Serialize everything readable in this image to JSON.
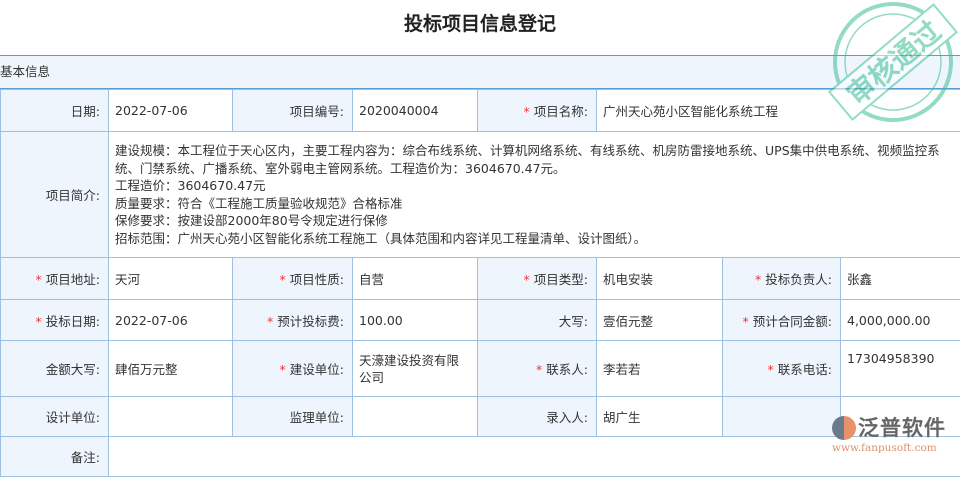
{
  "title": "投标项目信息登记",
  "section": "基本信息",
  "rows": {
    "date_label": "日期:",
    "date": "2022-07-06",
    "code_label": "项目编号:",
    "code": "2020040004",
    "name_label": "项目名称:",
    "name": "广州天心苑小区智能化系统工程",
    "intro_label": "项目简介:",
    "intro_lines": [
      "建设规模：本工程位于天心区内，主要工程内容为：综合布线系统、计算机网络系统、有线系统、机房防雷接地系统、UPS集中供电系统、视频监控系统、门禁系统、广播系统、室外弱电主管网系统。工程造价为：3604670.47元。",
      "工程造价：3604670.47元",
      "质量要求：符合《工程施工质量验收规范》合格标准",
      "保修要求：按建设部2000年80号令规定进行保修",
      "招标范围：广州天心苑小区智能化系统工程施工（具体范围和内容详见工程量清单、设计图纸）。"
    ],
    "address_label": "项目地址:",
    "address": "天河",
    "nature_label": "项目性质:",
    "nature": "自营",
    "type_label": "项目类型:",
    "type": "机电安装",
    "owner_label": "投标负责人:",
    "owner": "张鑫",
    "bid_date_label": "投标日期:",
    "bid_date": "2022-07-06",
    "fee_label": "预计投标费:",
    "fee": "100.00",
    "upper_label": "大写:",
    "upper": "壹佰元整",
    "contract_label": "预计合同金额:",
    "contract": "4,000,000.00",
    "amount_upper_label": "金额大写:",
    "amount_upper": "肆佰万元整",
    "builder_label": "建设单位:",
    "builder": "天濠建设投资有限公司",
    "contact_label": "联系人:",
    "contact": "李若若",
    "phone_label": "联系电话:",
    "phone": "17304958390",
    "design_label": "设计单位:",
    "design": "",
    "supervisor_label": "监理单位:",
    "supervisor": "",
    "recorder_label": "录入人:",
    "recorder": "胡广生",
    "remark_label": "备注:"
  },
  "stamp_text": "审核通过",
  "logo": {
    "name": "泛普软件",
    "url": "www.fanpusoft.com"
  },
  "required_mark": "*"
}
